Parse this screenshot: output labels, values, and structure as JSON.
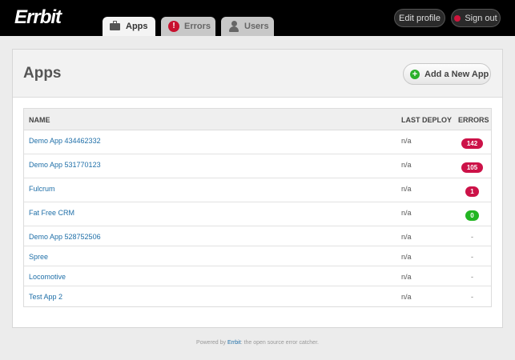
{
  "header": {
    "logo": "Errbit",
    "tabs": [
      {
        "label": "Apps",
        "icon": "briefcase-icon",
        "active": true
      },
      {
        "label": "Errors",
        "icon": "errors-icon",
        "icon_glyph": "!",
        "active": false
      },
      {
        "label": "Users",
        "icon": "users-icon",
        "active": false
      }
    ],
    "edit_profile_label": "Edit profile",
    "sign_out_label": "Sign out"
  },
  "main": {
    "title": "Apps",
    "add_button_label": "Add a New App",
    "add_icon_glyph": "+",
    "columns": [
      "NAME",
      "LAST DEPLOY",
      "ERRORS"
    ],
    "apps": [
      {
        "name": "Demo App 434462332",
        "last_deploy": "n/a",
        "errors": "142",
        "status": "red"
      },
      {
        "name": "Demo App 531770123",
        "last_deploy": "n/a",
        "errors": "105",
        "status": "red"
      },
      {
        "name": "Fulcrum",
        "last_deploy": "n/a",
        "errors": "1",
        "status": "red"
      },
      {
        "name": "Fat Free CRM",
        "last_deploy": "n/a",
        "errors": "0",
        "status": "green"
      },
      {
        "name": "Demo App 528752506",
        "last_deploy": "n/a",
        "errors": "-",
        "status": "none"
      },
      {
        "name": "Spree",
        "last_deploy": "n/a",
        "errors": "-",
        "status": "none"
      },
      {
        "name": "Locomotive",
        "last_deploy": "n/a",
        "errors": "-",
        "status": "none"
      },
      {
        "name": "Test App 2",
        "last_deploy": "n/a",
        "errors": "-",
        "status": "none"
      }
    ]
  },
  "footer": {
    "prefix": "Powered by ",
    "link": "Errbit",
    "suffix": ": the open source error catcher."
  },
  "colors": {
    "header_bg": "#000000",
    "link": "#1f6fa8",
    "badge_red": "#cc1248",
    "badge_green": "#22b522",
    "add_icon": "#2ab02a"
  }
}
